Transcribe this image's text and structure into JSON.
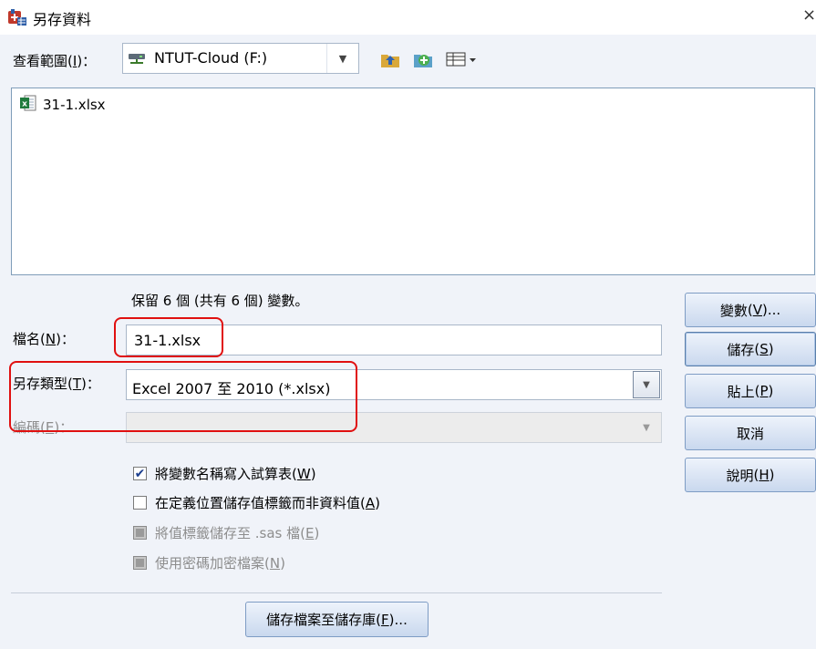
{
  "window": {
    "title": "另存資料",
    "close_glyph": "×"
  },
  "look_in": {
    "label": "查看範圍",
    "mnemonic": "I",
    "value": "NTUT-Cloud (F:)"
  },
  "toolbar_icons": [
    "up-folder-icon",
    "new-folder-icon",
    "view-menu-icon"
  ],
  "files": [
    {
      "name": "31-1.xlsx",
      "icon": "excel-file-icon"
    }
  ],
  "keep_info": "保留 6 個 (共有 6 個) 變數。",
  "filename": {
    "label": "檔名",
    "mnemonic": "N",
    "value": "31-1.xlsx"
  },
  "save_type": {
    "label": "另存類型",
    "mnemonic": "T",
    "value": "Excel 2007 至 2010 (*.xlsx)"
  },
  "encoding": {
    "label": "編碼",
    "mnemonic": "E",
    "value": ""
  },
  "checkboxes": [
    {
      "label": "將變數名稱寫入試算表",
      "mnemonic": "W",
      "checked": true,
      "enabled": true
    },
    {
      "label": "在定義位置儲存值標籤而非資料值",
      "mnemonic": "A",
      "checked": false,
      "enabled": true
    },
    {
      "label": "將值標籤儲存至 .sas 檔",
      "mnemonic": "E",
      "checked": false,
      "enabled": false
    },
    {
      "label": "使用密碼加密檔案",
      "mnemonic": "N",
      "checked": false,
      "enabled": false
    }
  ],
  "buttons": {
    "variables": {
      "label": "變數",
      "mnemonic": "V",
      "suffix": "..."
    },
    "save": {
      "label": "儲存",
      "mnemonic": "S",
      "suffix": ""
    },
    "paste": {
      "label": "貼上",
      "mnemonic": "P",
      "suffix": ""
    },
    "cancel": {
      "label": "取消"
    },
    "help": {
      "label": "說明",
      "mnemonic": "H",
      "suffix": ""
    },
    "repository": {
      "label": "儲存檔案至儲存庫",
      "mnemonic": "F",
      "suffix": "..."
    }
  },
  "colors": {
    "annotation": "#e01010",
    "accent": "#1c3f8f"
  }
}
